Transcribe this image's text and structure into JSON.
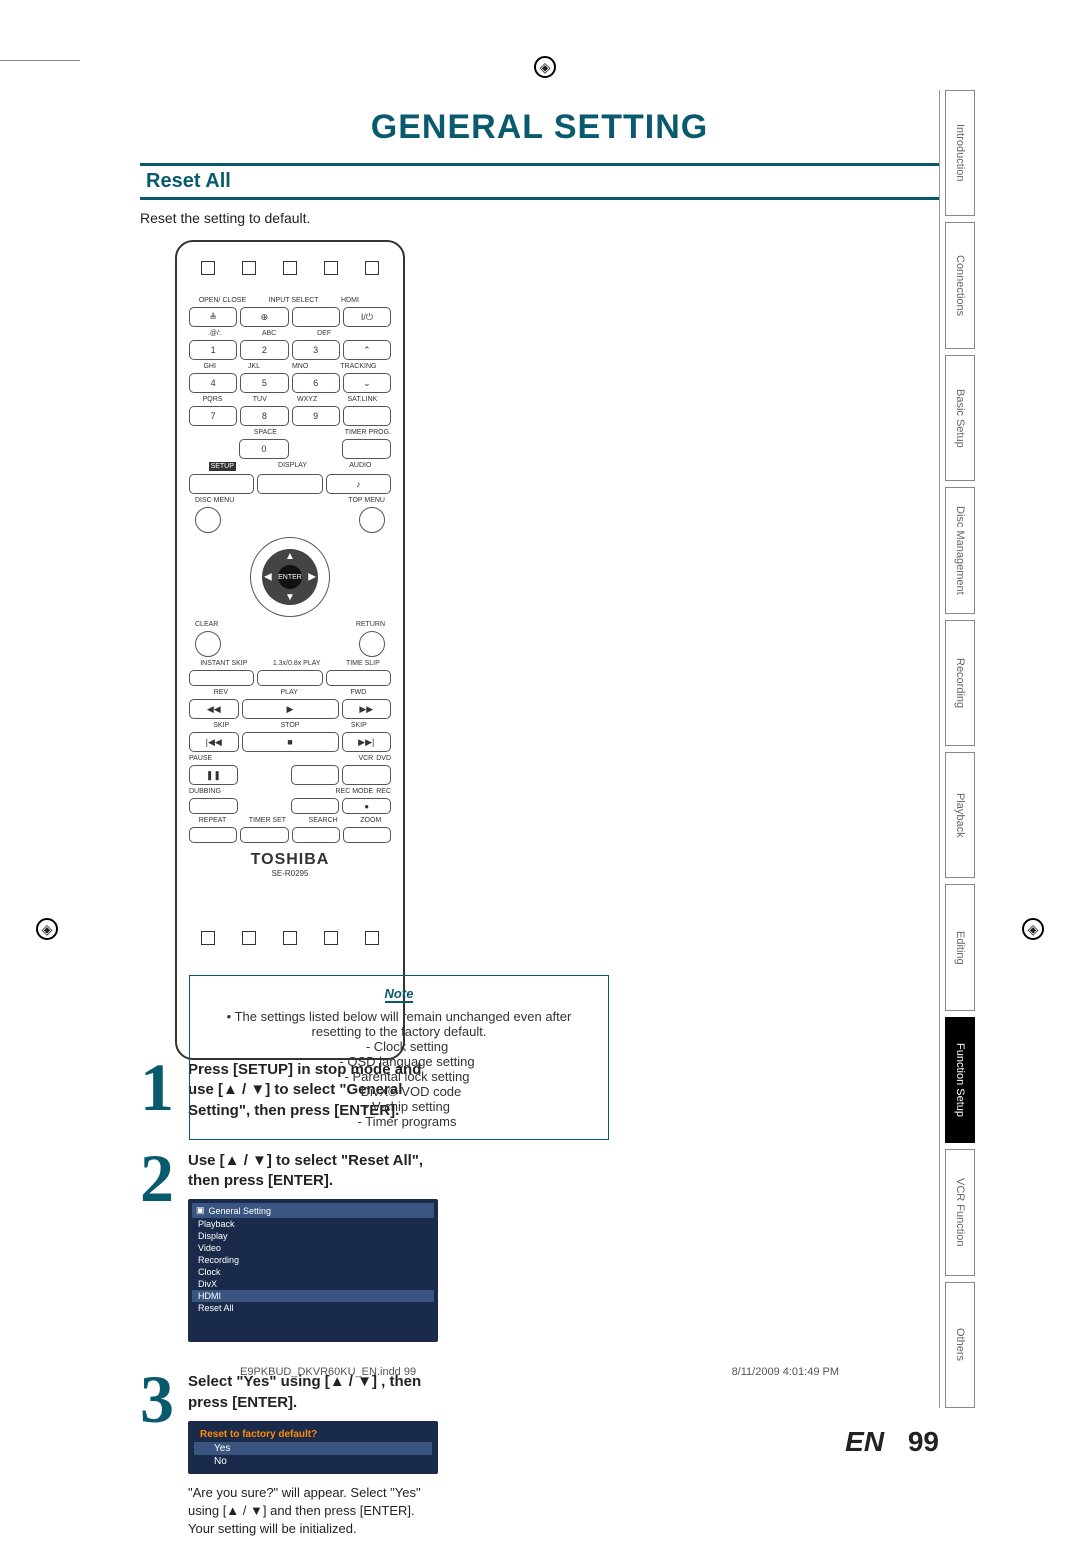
{
  "title": "GENERAL SETTING",
  "section": "Reset All",
  "intro": "Reset the setting to default.",
  "remote": {
    "labels_row1": [
      "OPEN/\nCLOSE",
      "INPUT\nSELECT",
      "HDMI",
      ""
    ],
    "labels_row2": [
      ".@/:",
      "ABC",
      "DEF",
      ""
    ],
    "num_row1": [
      "1",
      "2",
      "3",
      "⌃"
    ],
    "labels_row3": [
      "GHI",
      "JKL",
      "MNO",
      "TRACKING"
    ],
    "num_row2": [
      "4",
      "5",
      "6",
      "⌄"
    ],
    "labels_row4": [
      "PQRS",
      "TUV",
      "WXYZ",
      "SAT.LINK"
    ],
    "num_row3": [
      "7",
      "8",
      "9",
      ""
    ],
    "space_lbl": "SPACE",
    "zero": "0",
    "timer_prog": "TIMER\nPROG.",
    "setup": "SETUP",
    "display": "DISPLAY",
    "audio": "AUDIO",
    "disc_menu": "DISC MENU",
    "top_menu": "TOP MENU",
    "enter": "ENTER",
    "clear": "CLEAR",
    "return": "RETURN",
    "instant_skip": "INSTANT\nSKIP",
    "play13": "1.3x/0.8x\nPLAY",
    "time_slip": "TIME SLIP",
    "rev": "REV",
    "play": "PLAY",
    "fwd": "FWD",
    "skip": "SKIP",
    "stop": "STOP",
    "pause": "PAUSE",
    "vcr": "VCR",
    "dvd": "DVD",
    "dubbing": "DUBBING",
    "rec_mode": "REC MODE",
    "rec": "REC",
    "repeat": "REPEAT",
    "timer_set": "TIMER SET",
    "search": "SEARCH",
    "zoom": "ZOOM",
    "brand": "TOSHIBA",
    "model": "SE-R0295"
  },
  "steps": {
    "s1": {
      "num": "1",
      "text": "Press [SETUP] in stop mode and use [▲ / ▼] to select \"General Setting\", then press [ENTER]."
    },
    "s2": {
      "num": "2",
      "text": "Use [▲ / ▼] to select \"Reset All\", then press [ENTER].",
      "osd_title": "General Setting",
      "osd_items": [
        "Playback",
        "Display",
        "Video",
        "Recording",
        "Clock",
        "DivX",
        "HDMI",
        "Reset All"
      ]
    },
    "s3": {
      "num": "3",
      "text": "Select \"Yes\" using [▲ / ▼] , then press [ENTER].",
      "osd_q": "Reset to factory default?",
      "osd_yes": "Yes",
      "osd_no": "No",
      "post1": "\"Are you sure?\" will appear. Select \"Yes\" using [▲ / ▼] and then press [ENTER].",
      "post2": "Your setting will be initialized."
    }
  },
  "note": {
    "head": "Note",
    "line1": "The settings listed below will remain unchanged even after resetting to the factory default.",
    "items": [
      "Clock setting",
      "OSD language setting",
      "Parental lock setting",
      "DivX® VOD code",
      "V-chip setting",
      "Timer programs"
    ]
  },
  "tabs": [
    "Introduction",
    "Connections",
    "Basic Setup",
    "Disc\nManagement",
    "Recording",
    "Playback",
    "Editing",
    "Function Setup",
    "VCR Function",
    "Others"
  ],
  "footer": {
    "lang": "EN",
    "page": "99"
  },
  "printfoot": {
    "file": "E9PKBUD_DKVR60KU_EN.indd   99",
    "date": "8/11/2009   4:01:49 PM"
  }
}
